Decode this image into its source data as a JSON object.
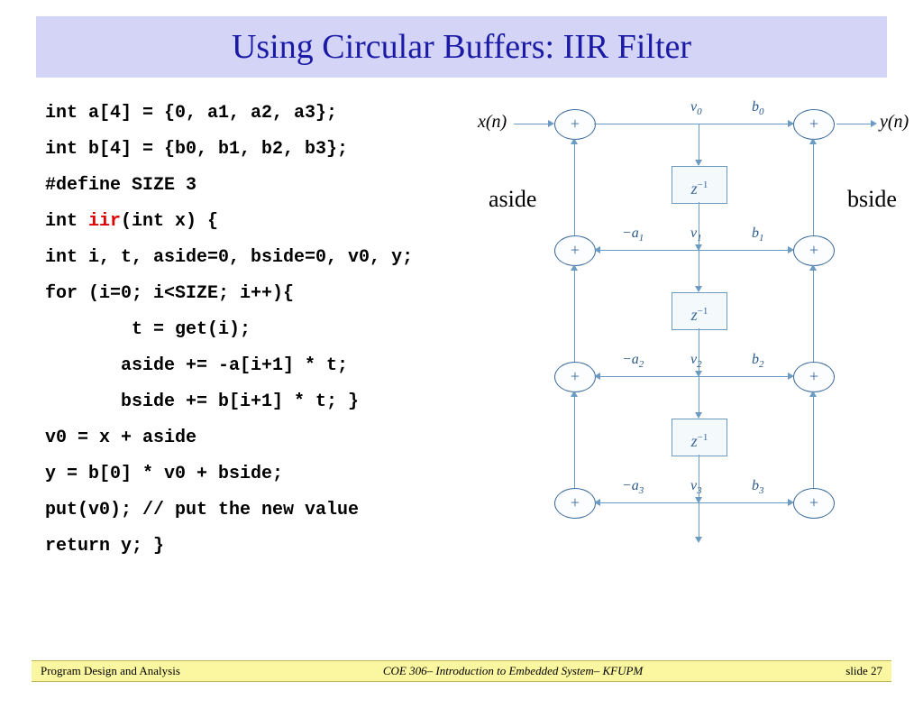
{
  "title": "Using Circular Buffers: IIR Filter",
  "code": {
    "l1": "int a[4] = {0, a1, a2, a3};",
    "l2": "int b[4] = {b0, b1, b2, b3};",
    "l3": "#define SIZE 3",
    "l4a": "int ",
    "l4b": "iir",
    "l4c": "(int x) {",
    "l5": "int i, t, aside=0, bside=0, v0, y;",
    "l6": "for (i=0; i<SIZE; i++){",
    "l7": "        t = get(i);",
    "l8": "       aside += -a[i+1] * t;",
    "l9": "       bside += b[i+1] * t; }",
    "l10": "v0 = x + aside",
    "l11": "y = b[0] * v0 + bside;",
    "l12": "put(v0); // put the new value",
    "l13": "return y; }"
  },
  "diagram": {
    "xn": "x(n)",
    "yn": "y(n)",
    "aside": "aside",
    "bside": "bside",
    "plus": "+",
    "delay": "z",
    "delay_exp": "−1",
    "v0": "v",
    "v0s": "0",
    "v1": "v",
    "v1s": "1",
    "v2": "v",
    "v2s": "2",
    "v3": "v",
    "v3s": "3",
    "b0": "b",
    "b0s": "0",
    "b1": "b",
    "b1s": "1",
    "b2": "b",
    "b2s": "2",
    "b3": "b",
    "b3s": "3",
    "na1": "−a",
    "a1s": "1",
    "na2": "−a",
    "a2s": "2",
    "na3": "−a",
    "a3s": "3"
  },
  "footer": {
    "left": "Program Design and Analysis",
    "mid": "COE 306– Introduction to Embedded System– KFUPM",
    "right": "slide 27"
  }
}
